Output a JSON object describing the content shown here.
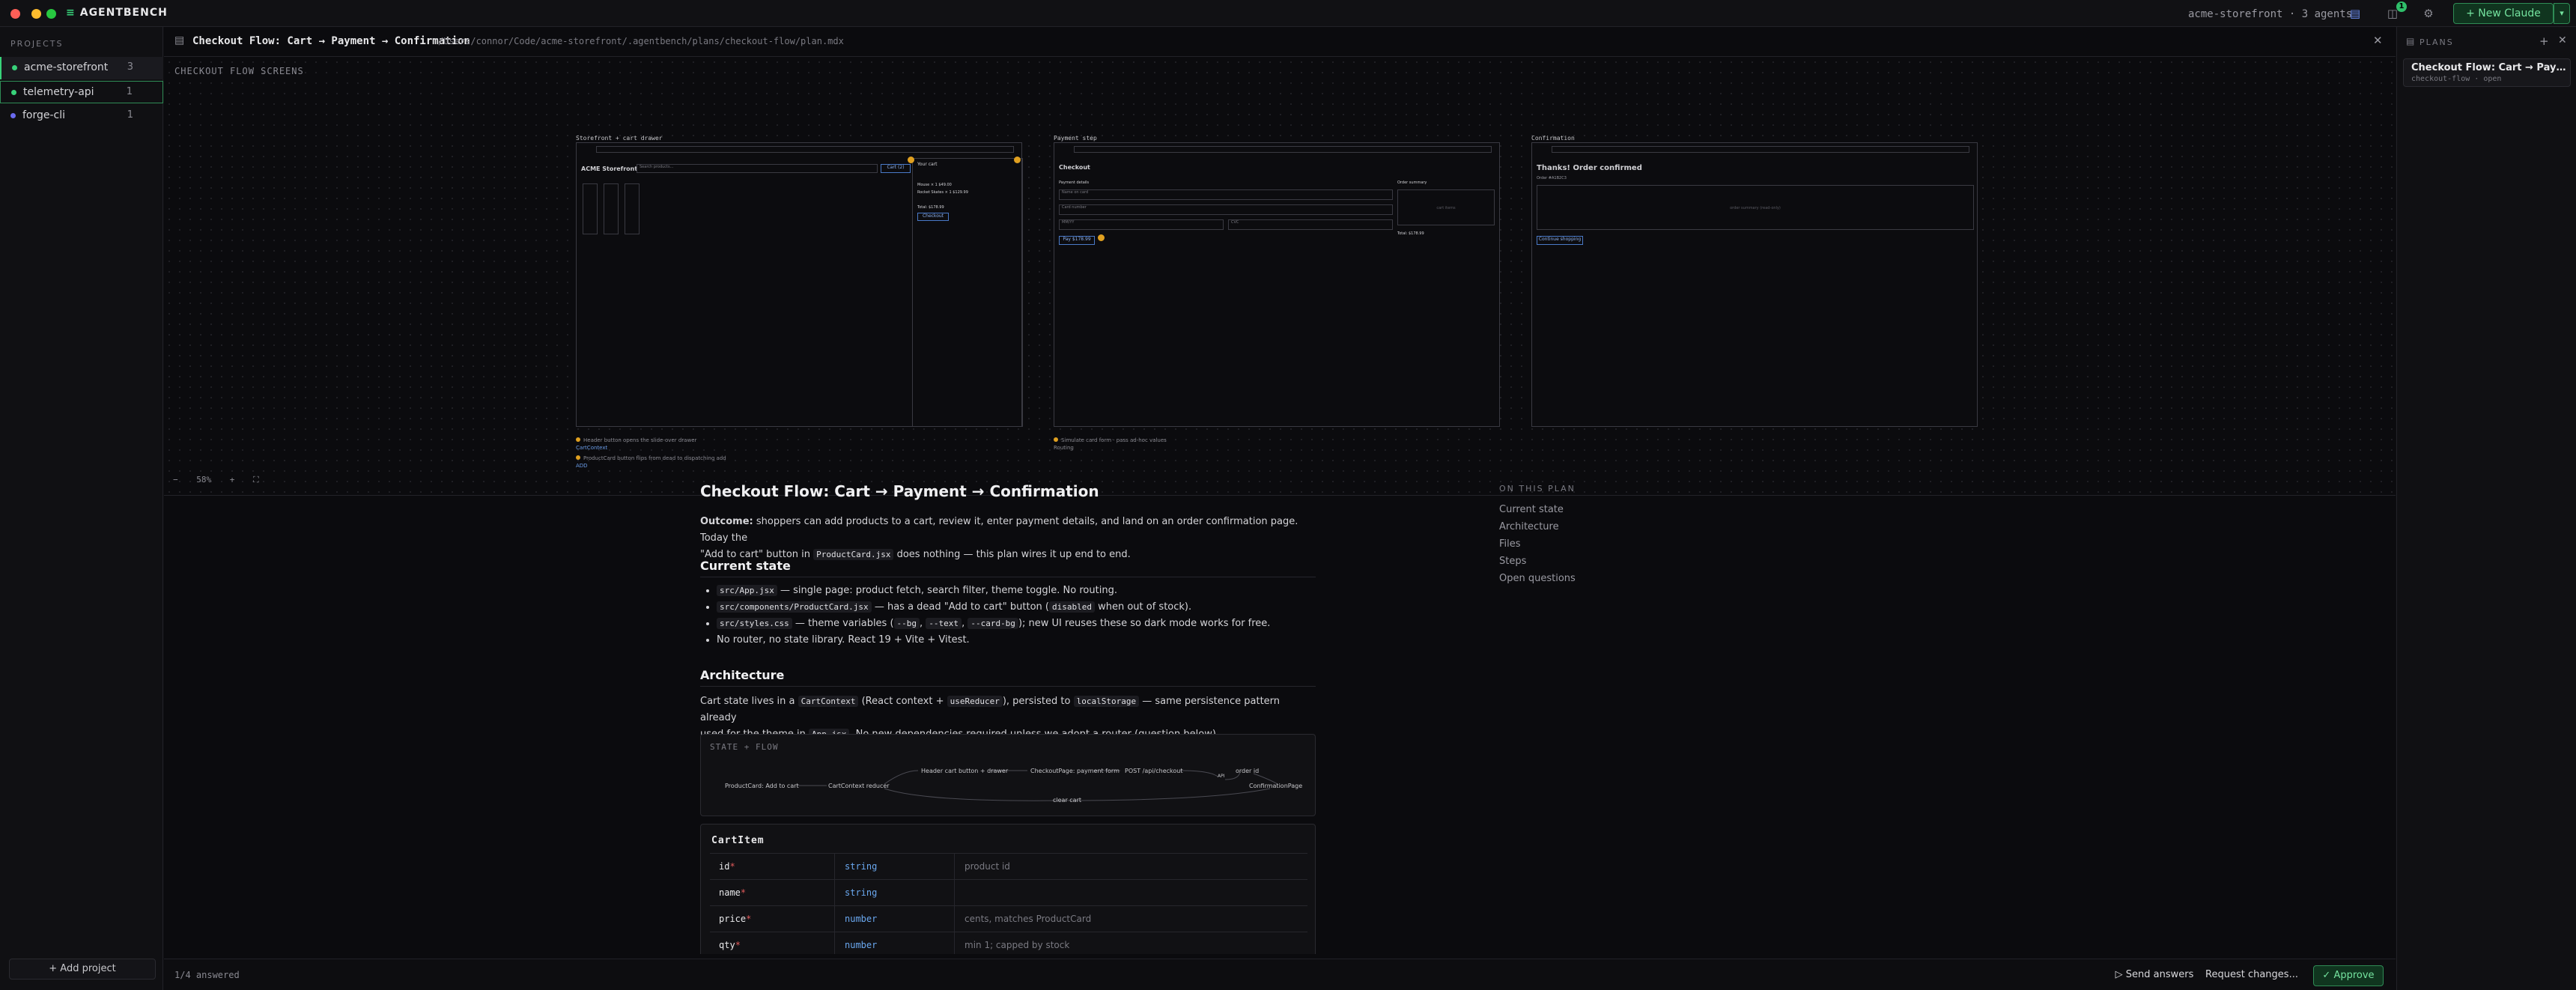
{
  "app": {
    "brand": "AGENTBENCH",
    "summary": "acme-storefront · 3 agents",
    "new_claude_label": "+ New Claude",
    "badge_count": "1"
  },
  "sidebar": {
    "heading": "PROJECTS",
    "projects": [
      {
        "name": "acme-storefront",
        "count": "3",
        "dot_color": "#38d27a"
      },
      {
        "name": "telemetry-api",
        "count": "1",
        "dot_color": "#38d27a"
      },
      {
        "name": "forge-cli",
        "count": "1",
        "dot_color": "#6a6aee"
      }
    ],
    "add_project_label": "+ Add project"
  },
  "doc_header": {
    "title": "Checkout Flow: Cart → Payment → Confirmation",
    "path": "/Users/connor/Code/acme-storefront/.agentbench/plans/checkout-flow/plan.mdx"
  },
  "screens": {
    "label": "CHECKOUT FLOW SCREENS",
    "zoom": "58%",
    "storefront": {
      "label": "Storefront + cart drawer",
      "heading": "ACME Storefront",
      "search_placeholder": "Search products...",
      "cart_button": "Cart (2)",
      "drawer_title": "Your cart",
      "item1": "Mouse × 1  $49.00",
      "item2": "Rocket Skates × 1  $129.99",
      "total": "Total: $178.99",
      "checkout": "Checkout",
      "annotation1": "Header button opens the slide-over drawer",
      "annotation1_sub": "CartContext",
      "annotation2": "ProductCard button flips from dead to dispatching add",
      "annotation2_sub": "ADD"
    },
    "payment": {
      "label": "Payment step",
      "heading": "Checkout",
      "details": "Payment details",
      "summary": "Order summary",
      "name_ph": "Name on card",
      "card_ph": "Card number",
      "exp_ph": "MM/YY",
      "cvc_ph": "CVC",
      "summary_ph": "cart items",
      "total": "Total: $178.99",
      "pay": "Pay $178.99",
      "annotation1": "Simulate card form  ·  pass ad-hoc values",
      "annotation1_sub": "Routing"
    },
    "confirmation": {
      "label": "Confirmation",
      "heading": "Thanks! Order confirmed",
      "order": "Order #A1B2C3",
      "summary_ph": "order summary (read-only)",
      "continue": "Continue shopping"
    }
  },
  "doc": {
    "title": "Checkout Flow: Cart → Payment → Confirmation",
    "outcome_label": "Outcome:",
    "outcome_1": " shoppers can add products to a cart, review it, enter payment details, and land on an order confirmation page. Today the",
    "outcome_2a": "\"Add to cart\" button in ",
    "outcome_code": "ProductCard.jsx",
    "outcome_2b": " does nothing — this plan wires it up end to end.",
    "current_state_heading": "Current state",
    "cs1_code": "src/App.jsx",
    "cs1_text": " — single page: product fetch, search filter, theme toggle. No routing.",
    "cs2_code": "src/components/ProductCard.jsx",
    "cs2_text_a": " — has a dead \"Add to cart\" button (",
    "cs2_code2": "disabled",
    "cs2_text_b": " when out of stock).",
    "cs3_code": "src/styles.css",
    "cs3_text_a": " — theme variables (",
    "cs3_v1": "--bg",
    "cs3_v2": "--text",
    "cs3_v3": "--card-bg",
    "cs3_text_b": "); new UI reuses these so dark mode works for free.",
    "cs4_text": "No router, no state library. React 19 + Vite + Vitest.",
    "architecture_heading": "Architecture",
    "arch_1a": "Cart state lives in a ",
    "arch_code1": "CartContext",
    "arch_1b": " (React context + ",
    "arch_code2": "useReducer",
    "arch_1c": "), persisted to ",
    "arch_code3": "localStorage",
    "arch_1d": " — same persistence pattern already",
    "arch_2a": "used for the theme in ",
    "arch_code4": "App.jsx",
    "arch_2b": ". No new dependencies required unless we adopt a router (question below).",
    "flow": {
      "label": "STATE + FLOW",
      "n1": "ProductCard: Add to cart",
      "n2": "CartContext reducer",
      "n3": "Header cart button + drawer",
      "n4": "CheckoutPage: payment form",
      "n5": "POST /api/checkout",
      "n6": "order id",
      "n7": "ConfirmationPage",
      "n8": "clear cart",
      "n9": "API"
    },
    "cartitem": {
      "title": "CartItem",
      "rows": [
        {
          "field": "id",
          "type": "string",
          "desc": "product id"
        },
        {
          "field": "name",
          "type": "string",
          "desc": ""
        },
        {
          "field": "price",
          "type": "number",
          "desc": "cents, matches ProductCard"
        },
        {
          "field": "qty",
          "type": "number",
          "desc": "min 1; capped by stock"
        }
      ],
      "required_mark": "*"
    }
  },
  "toc": {
    "heading": "ON THIS PLAN",
    "items": [
      "Current state",
      "Architecture",
      "Files",
      "Steps",
      "Open questions"
    ]
  },
  "bottom": {
    "answered": "1/4 answered",
    "send": "Send answers",
    "request": "Request changes...",
    "approve": "✓ Approve"
  },
  "plans": {
    "heading": "PLANS",
    "card_title": "Checkout Flow: Cart → Payment...",
    "card_sub": "checkout-flow · open"
  }
}
